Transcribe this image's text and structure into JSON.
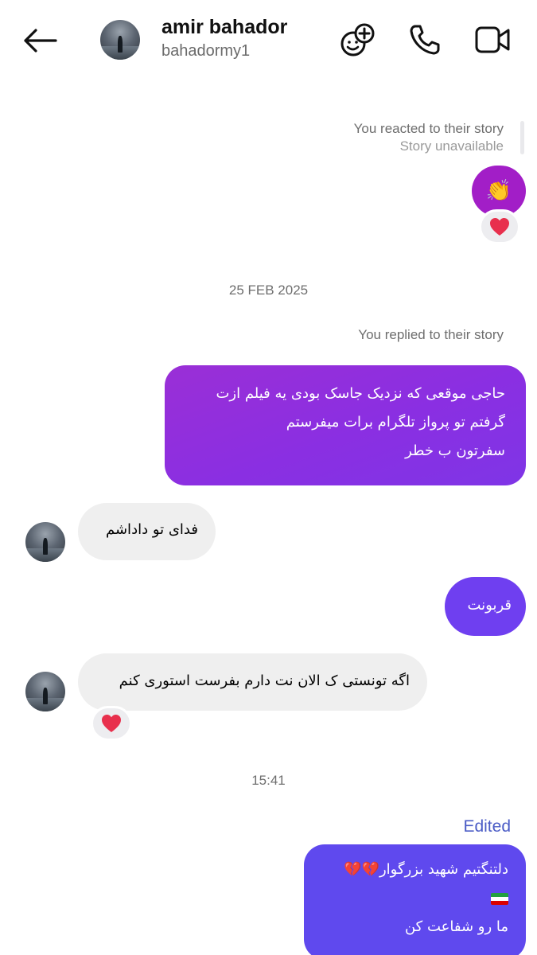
{
  "header": {
    "name": "amir bahador",
    "username": "bahadormy1"
  },
  "story_reaction": {
    "label": "You reacted to their story",
    "status": "Story unavailable",
    "emoji": "👏",
    "reaction": "heart"
  },
  "date_1": "25 FEB 2025",
  "story_reply": {
    "label": "You replied to their story",
    "lines": [
      "حاجی موقعی که نزدیک جاسک بودی یه فیلم ازت",
      "گرفتم تو پرواز تلگرام برات میفرستم",
      "سفرتون ب خطر"
    ]
  },
  "messages": {
    "in_1": "فدای تو داداشم",
    "out_2": "قربونت",
    "in_2": "اگه تونستی ک الان نت دارم بفرست استوری کنم",
    "in_2_reaction": "heart"
  },
  "date_2": "15:41",
  "last_message": {
    "edited_label": "Edited",
    "line_1": "دلتنگتیم شهید بزرگوار",
    "line_1_emojis": "💔💔",
    "flag": "iran-flag",
    "line_3": "ما رو شفاعت کن"
  },
  "colors": {
    "story_bubble": "#a21ec7",
    "reply_gradient_start": "#9a2fd6",
    "reply_gradient_end": "#7f35e6",
    "out_bubble_2": "#6f3ff0",
    "out_bubble_3": "#5f49ee",
    "in_bubble": "#efefef",
    "edited": "#4b5cc6"
  }
}
